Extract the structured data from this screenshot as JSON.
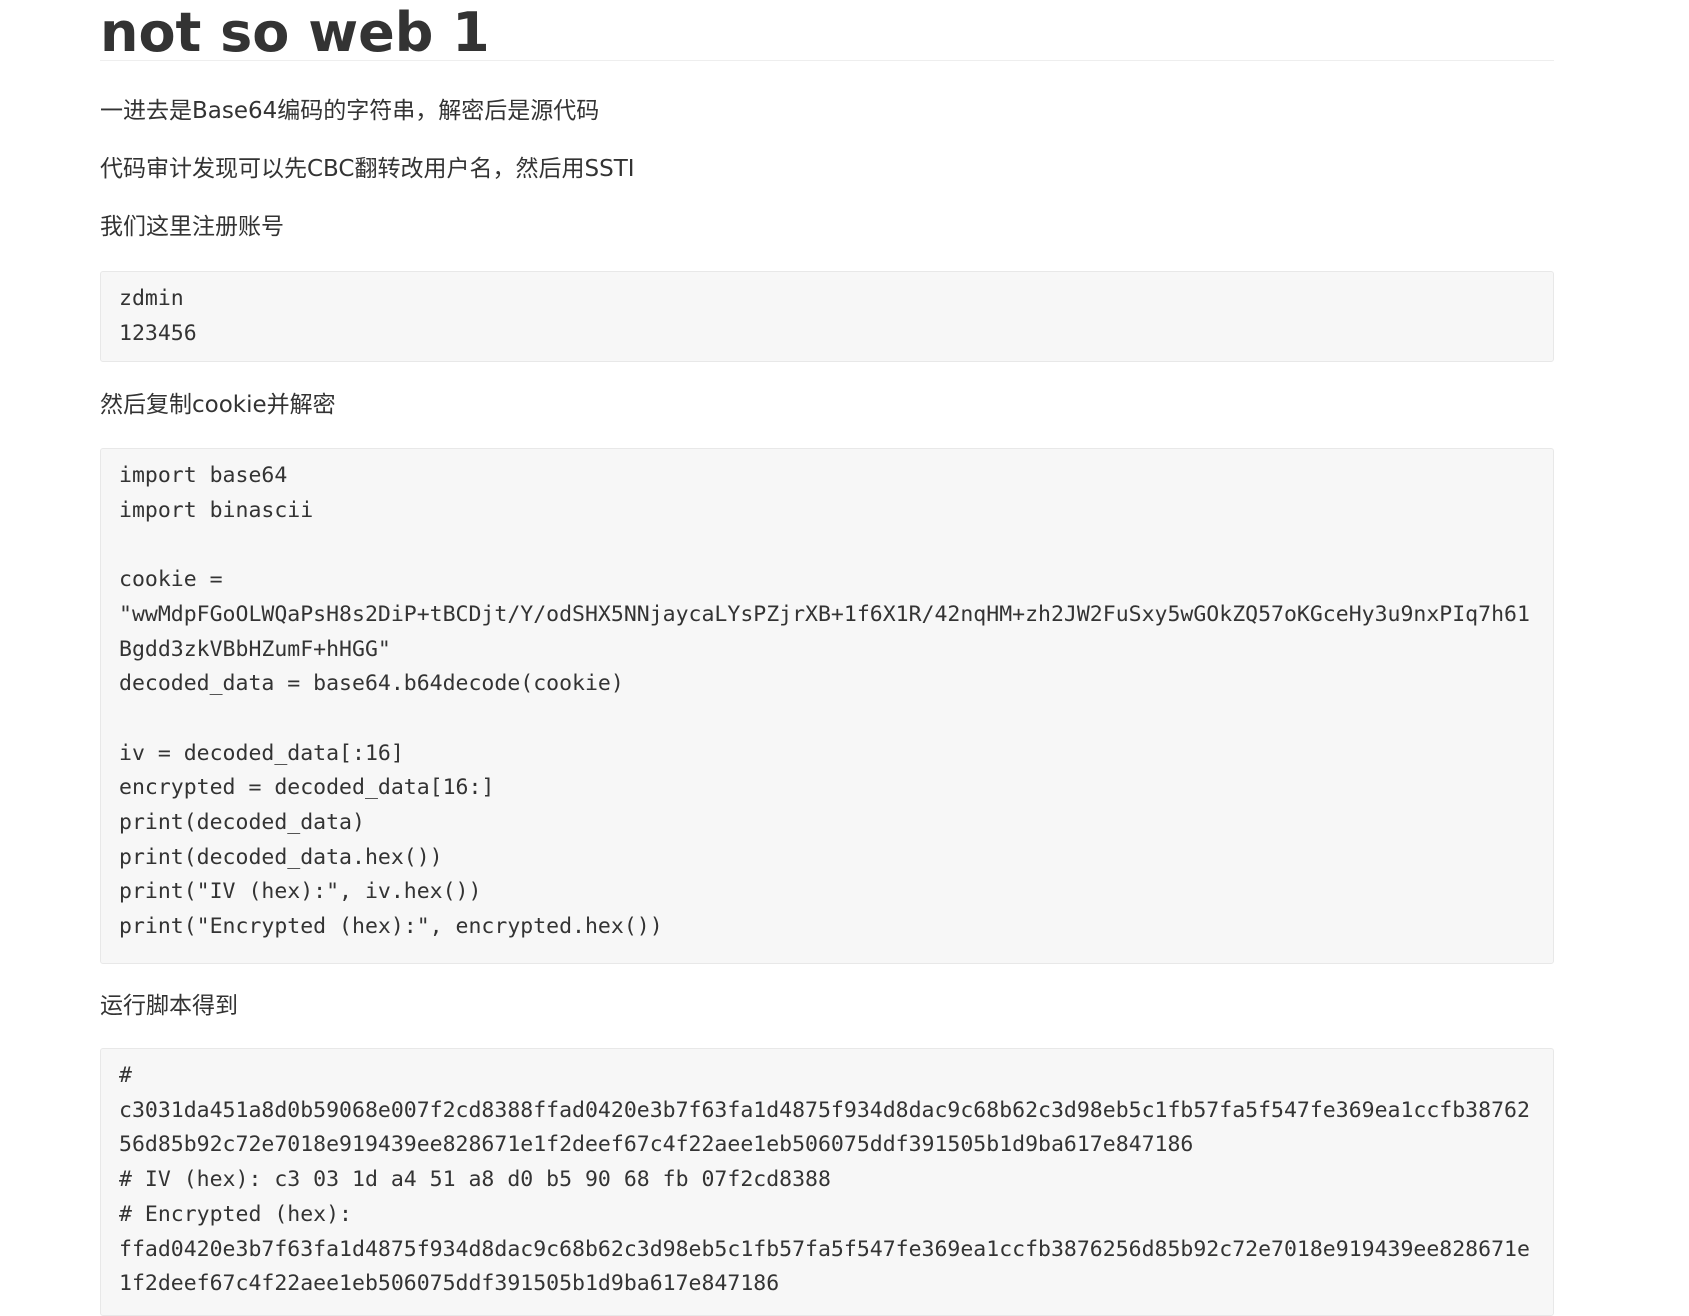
{
  "title": "not so web 1",
  "paragraphs": {
    "p1": "一进去是Base64编码的字符串，解密后是源代码",
    "p2": "代码审计发现可以先CBC翻转改用户名，然后用SSTI",
    "p3": "我们这里注册账号",
    "p4": "然后复制cookie并解密",
    "p5": "运行脚本得到"
  },
  "code_blocks": {
    "register": "zdmin\n123456",
    "decrypt_script": "import base64\nimport binascii\n\ncookie = \n\"wwMdpFGoOLWQaPsH8s2DiP+tBCDjt/Y/odSHX5NNjaycaLYsPZjrXB+1f6X1R/42nqHM+zh2JW2FuSxy5wGOkZQ57oKGceHy3u9nxPIq7h61Bgdd3zkVBbHZumF+hHGG\"\ndecoded_data = base64.b64decode(cookie)\n\niv = decoded_data[:16]\nencrypted = decoded_data[16:]\nprint(decoded_data)\nprint(decoded_data.hex())\nprint(\"IV (hex):\", iv.hex())\nprint(\"Encrypted (hex):\", encrypted.hex())",
    "output": "# \nc3031da451a8d0b59068e007f2cd8388ffad0420e3b7f63fa1d4875f934d8dac9c68b62c3d98eb5c1fb57fa5f547fe369ea1ccfb3876256d85b92c72e7018e919439ee828671e1f2deef67c4f22aee1eb506075ddf391505b1d9ba617e847186\n# IV (hex): c3 03 1d a4 51 a8 d0 b5 90 68 fb 07f2cd8388\n# Encrypted (hex): \nffad0420e3b7f63fa1d4875f934d8dac9c68b62c3d98eb5c1fb57fa5f547fe369ea1ccfb3876256d85b92c72e7018e919439ee828671e1f2deef67c4f22aee1eb506075ddf391505b1d9ba617e847186"
  }
}
